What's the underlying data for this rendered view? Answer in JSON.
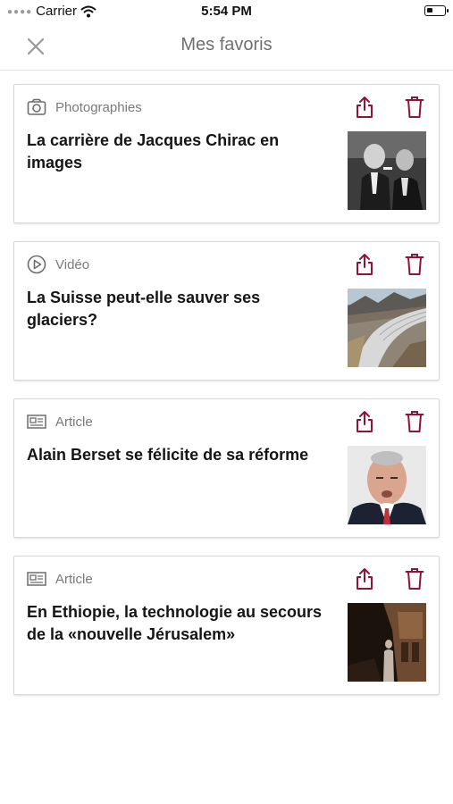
{
  "status_bar": {
    "carrier": "Carrier",
    "time": "5:54 PM"
  },
  "header": {
    "title": "Mes favoris",
    "close_icon": "close-icon"
  },
  "colors": {
    "accent": "#8c1538",
    "icon_gray": "#6d6d6d",
    "title_gray": "#707070"
  },
  "favorites": [
    {
      "category": "Photographies",
      "category_icon": "camera-icon",
      "title": "La carrière de Jacques Chirac en images"
    },
    {
      "category": "Vidéo",
      "category_icon": "play-circle-icon",
      "title": "La Suisse peut-elle sauver ses glaciers?"
    },
    {
      "category": "Article",
      "category_icon": "newspaper-icon",
      "title": "Alain Berset se félicite de sa réforme"
    },
    {
      "category": "Article",
      "category_icon": "newspaper-icon",
      "title": "En Ethiopie, la technologie au secours de la «nouvelle Jérusalem»"
    }
  ]
}
